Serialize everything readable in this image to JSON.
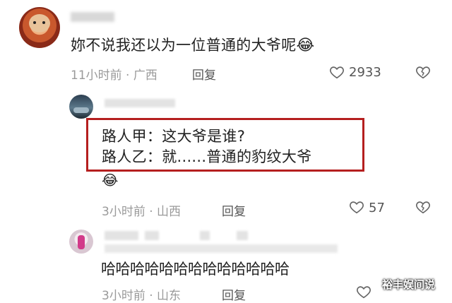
{
  "comments": [
    {
      "text": "妳不说我还以为一位普通的大爷呢",
      "emoji": "😂",
      "time_location": "11小时前 · 广西",
      "reply_label": "回复",
      "likes": "2933"
    },
    {
      "quote_line1": "路人甲：这大爷是谁?",
      "quote_line2": "路人乙：就......普通的豹纹大爷",
      "emoji": "😂",
      "time_location": "3小时前 · 山西",
      "reply_label": "回复",
      "likes": "57"
    },
    {
      "text": "哈哈哈哈哈哈哈哈哈哈哈哈哈",
      "time_location": "3小时前 · 山东",
      "reply_label": "回复",
      "likes": ""
    }
  ],
  "watermark": "裕丰娱间说",
  "colors": {
    "highlight_border": "#b51f1f",
    "meta_gray": "#9a9a9a"
  }
}
